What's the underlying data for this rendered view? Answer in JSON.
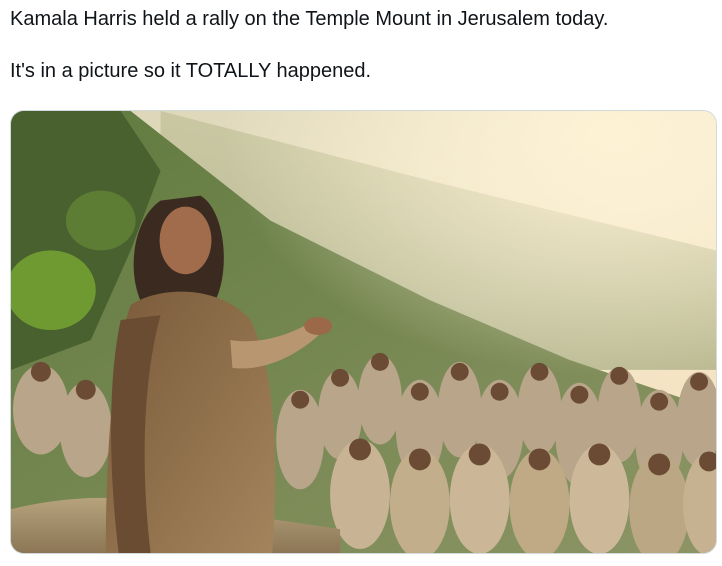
{
  "post": {
    "line1": "Kamala Harris held a rally on the Temple Mount in Jerusalem today.",
    "line2": "It's in a picture so it TOTALLY happened."
  },
  "media": {
    "alt": "AI-generated image of a woman in robes speaking to a seated crowd on a hillside",
    "colors": {
      "sky": "#f3e9cf",
      "hill": "#7f8f5a",
      "robe": "#8a6a48",
      "crowd": "#b8a58a"
    }
  }
}
